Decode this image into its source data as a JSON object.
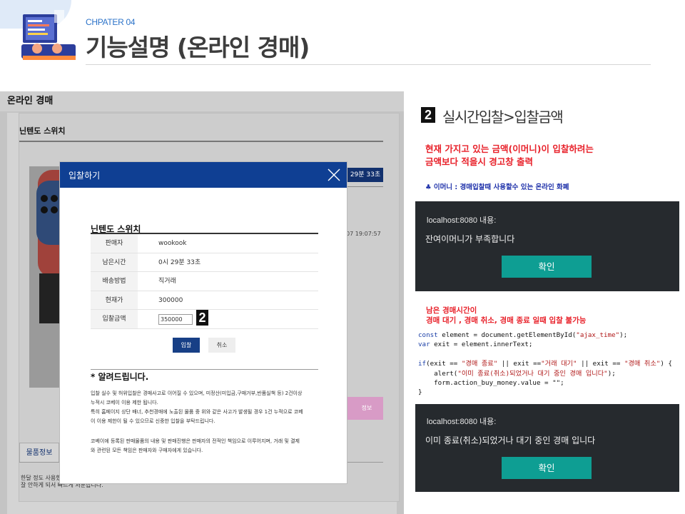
{
  "header": {
    "chapter": "CHPATER 04",
    "title": "기능설명 (온라인 경매)"
  },
  "screenshot": {
    "page_title": "온라인 경매",
    "product_title": "닌텐도 스위치",
    "time_badge": "29분 33초",
    "date_fragment": "07 19:07:57",
    "pink_button": "정보",
    "bottom_tab": "물품정보",
    "bottom_note": "한달 정도 사용했\n잘 안하게 되서 빠르게 처분합니다.",
    "modal": {
      "title": "입찰하기",
      "product_name": "닌텐도 스위치",
      "rows": [
        {
          "label": "판매자",
          "value": "wookook"
        },
        {
          "label": "남은시간",
          "value": "0시 29분 33초"
        },
        {
          "label": "배송방법",
          "value": "직거래"
        },
        {
          "label": "현재가",
          "value": "300000"
        },
        {
          "label": "입찰금액",
          "input_value": "350000"
        }
      ],
      "badge": "2",
      "bid_button": "입찰",
      "cancel_button": "취소",
      "notice_title": "* 알려드립니다.",
      "notice_p1": "입찰 실수 및 허위입찰은 경매사고로 이어질 수 있으며, 미정산(미입금,구매거부,반품실책 등) 2건이상\n누적시 코베이 이용 제한 됩니다.\n특히 홈페이지 상단 배너, 추천경매에 노출된 물품 중 위와 같은 사고가 발생될 경우 1건 누적으로 코베\n이 이용 제한이 될 수 있으므로 신중한 입찰을 부탁드립니다.",
      "notice_p2": "코베이에 등록된 판매물품의 내용 및 판매진행은 판매자의 전적인 책임으로 이루어지며, 거래 및 결제\n와 관련된 모든 책임은 판매자와 구매자에게 있습니다."
    }
  },
  "right": {
    "section_badge": "2",
    "section_title": "실시간입찰>입찰금액",
    "red_note": "현재 가지고 있는 금액(이머니)이 입찰하려는\n금액보다 적을시 경고창 출력",
    "emoney_note": "♣ 이머니 : 경매입찰때 사용할수 있는 온라인 화폐",
    "dialog1": {
      "host": "localhost:8080 내용:",
      "message": "잔여이머니가 부족합니다",
      "ok": "확인"
    },
    "red_note2": "남은 경매시간이\n경매 대기 , 경매 취소, 경매 종료 일때 입찰 불가능",
    "code": {
      "l1_kw": "const",
      "l1_rest": " element = document.getElementById(",
      "l1_str": "\"ajax_time\"",
      "l1_end": ");",
      "l2_kw": "var",
      "l2_rest": " exit = element.innerText;",
      "l4_kw": "if",
      "l4_a": "(exit == ",
      "l4_s1": "\"경매 종료\"",
      "l4_b": " || exit ==",
      "l4_s2": "\"거래 대기\"",
      "l4_c": " || exit == ",
      "l4_s3": "\"경매 취소\"",
      "l4_d": ") {",
      "l5_a": "    alert(",
      "l5_s": "\"이미 종료(취소)되었거나 대기 중인 경매 입니다\"",
      "l5_b": ");",
      "l6": "    form.action_buy_money.value = \"\";",
      "l7": "}"
    },
    "dialog2": {
      "host": "localhost:8080 내용:",
      "message": "이미 종료(취소)되었거나 대기 중인 경매 입니다",
      "ok": "확인"
    }
  },
  "colors": {
    "accent_blue": "#0f3f93",
    "dialog_bg": "#262a2e",
    "ok_button": "#0e9e93",
    "warning_red": "#e8212a"
  }
}
